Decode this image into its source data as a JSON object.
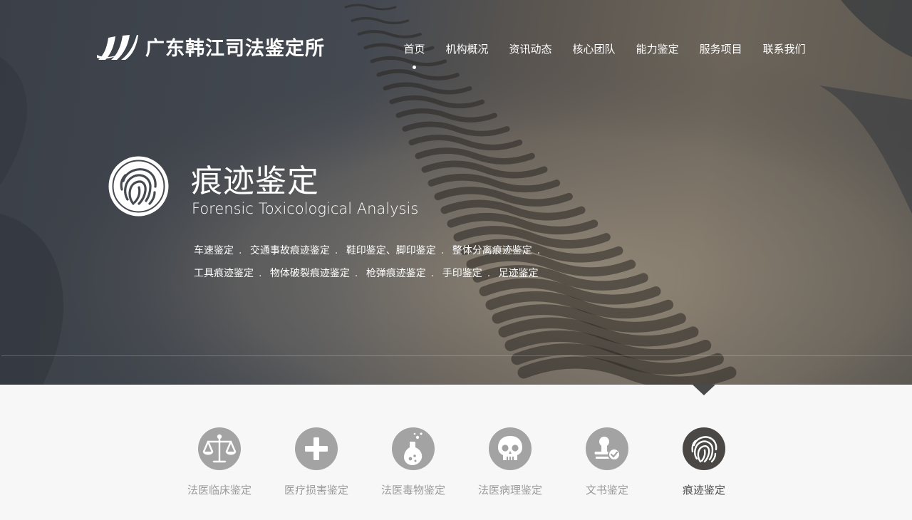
{
  "site": {
    "logo_text": "广东韩江司法鉴定所"
  },
  "nav": [
    {
      "label": "首页",
      "active": true
    },
    {
      "label": "机构概况"
    },
    {
      "label": "资讯动态"
    },
    {
      "label": "核心团队"
    },
    {
      "label": "能力鉴定"
    },
    {
      "label": "服务项目"
    },
    {
      "label": "联系我们"
    }
  ],
  "hero": {
    "icon": "fingerprint-icon",
    "title": "痕迹鉴定",
    "subtitle": "Forensic Toxicological Analysis",
    "tags_line1": [
      "车速鉴定",
      "交通事故痕迹鉴定",
      "鞋印鉴定、脚印鉴定",
      "整体分离痕迹鉴定"
    ],
    "tags_line2": [
      "工具痕迹鉴定",
      "物体破裂痕迹鉴定",
      "枪弹痕迹鉴定",
      "手印鉴定",
      "足迹鉴定"
    ],
    "separator": "."
  },
  "services": [
    {
      "label": "法医临床鉴定",
      "icon": "scales-icon"
    },
    {
      "label": "医疗损害鉴定",
      "icon": "medical-cross-icon"
    },
    {
      "label": "法医毒物鉴定",
      "icon": "flask-icon"
    },
    {
      "label": "法医病理鉴定",
      "icon": "skull-icon"
    },
    {
      "label": "文书鉴定",
      "icon": "document-stamp-icon"
    },
    {
      "label": "痕迹鉴定",
      "icon": "fingerprint-icon",
      "active": true
    }
  ],
  "colors": {
    "hero_dark": "#3b4048",
    "accent_dark": "#4a4744",
    "icon_gray": "#a3a3a3",
    "label_gray": "#9a9a9a",
    "bottom_bg": "#f7f7f7"
  }
}
